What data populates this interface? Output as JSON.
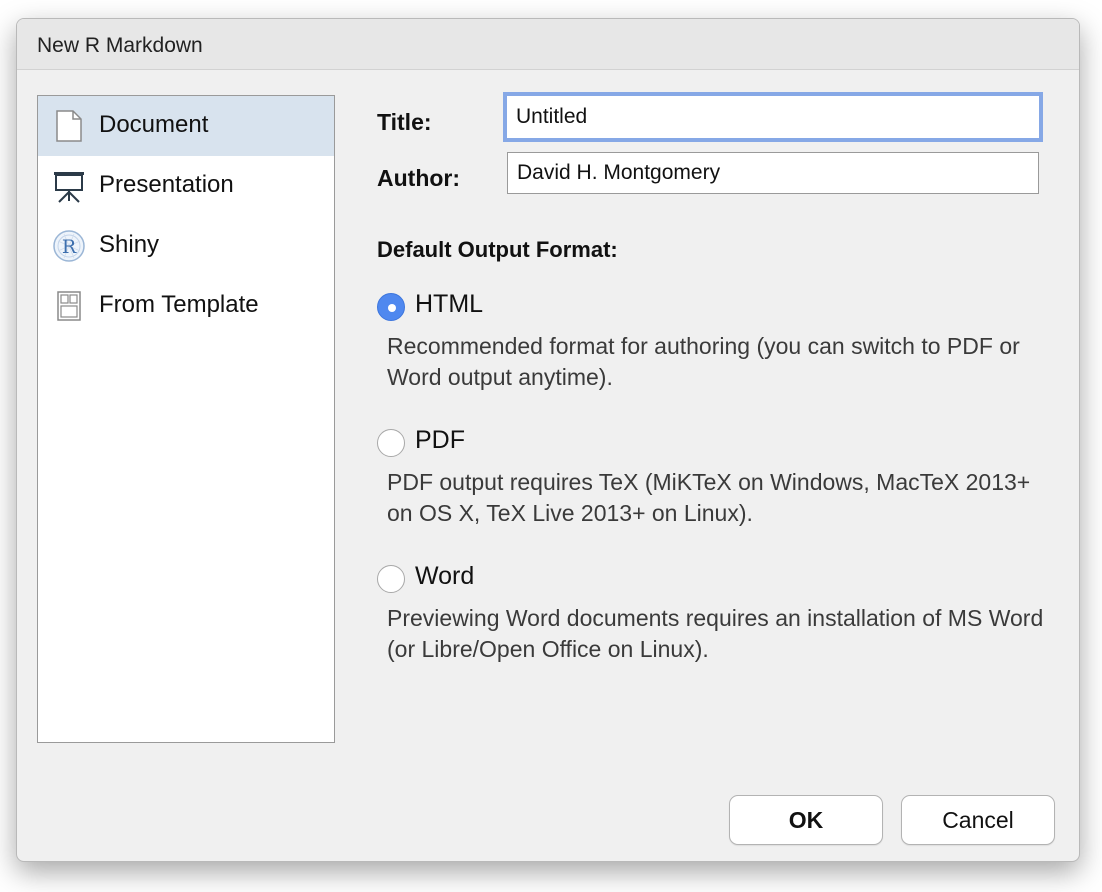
{
  "window": {
    "title": "New R Markdown"
  },
  "sidebar": {
    "items": [
      {
        "label": "Document",
        "icon": "document-icon",
        "selected": true
      },
      {
        "label": "Presentation",
        "icon": "presentation-icon",
        "selected": false
      },
      {
        "label": "Shiny",
        "icon": "shiny-r-icon",
        "selected": false
      },
      {
        "label": "From Template",
        "icon": "template-icon",
        "selected": false
      }
    ]
  },
  "form": {
    "title_label": "Title:",
    "title_value": "Untitled",
    "author_label": "Author:",
    "author_value": "David H. Montgomery"
  },
  "output_format": {
    "heading": "Default Output Format:",
    "options": [
      {
        "label": "HTML",
        "selected": true,
        "description": "Recommended format for authoring (you can switch to PDF or Word output anytime)."
      },
      {
        "label": "PDF",
        "selected": false,
        "description": "PDF output requires TeX (MiKTeX on Windows, MacTeX 2013+ on OS X, TeX Live 2013+ on Linux)."
      },
      {
        "label": "Word",
        "selected": false,
        "description": "Previewing Word documents requires an installation of MS Word (or Libre/Open Office on Linux)."
      }
    ]
  },
  "buttons": {
    "ok": "OK",
    "cancel": "Cancel"
  },
  "colors": {
    "selection": "#d8e3ee",
    "accent": "#4f88ef",
    "focus_ring": "#86a8e6"
  }
}
